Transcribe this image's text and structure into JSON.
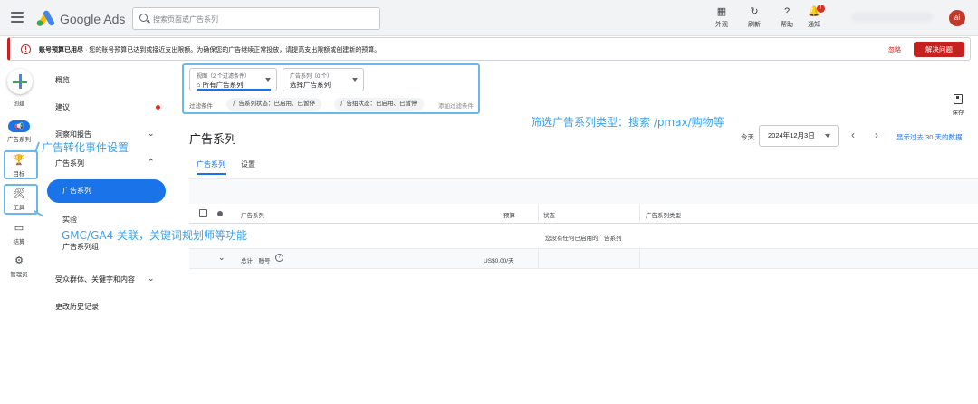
{
  "header": {
    "app_name": "Google Ads",
    "search_placeholder": "搜索页面或广告系列",
    "buttons": [
      {
        "label": "外观",
        "icon": "appearance-icon"
      },
      {
        "label": "刷新",
        "icon": "refresh-icon"
      },
      {
        "label": "帮助",
        "icon": "help-icon"
      },
      {
        "label": "通知",
        "icon": "bell-icon",
        "badge": "!"
      }
    ],
    "avatar_text": "ai"
  },
  "alert": {
    "title": "账号预算已用尽",
    "message": " · 您的账号预算已达到或接近支出限额。为确保您的广告继续正常投放，请提高支出限额或创建新的预算。",
    "ignore_label": "忽略",
    "resolve_label": "解决问题"
  },
  "rail": {
    "create": "创建",
    "campaigns": "广告系列",
    "goals": "目标",
    "tools": "工具",
    "billing": "结算",
    "admin": "管理员"
  },
  "nav": {
    "overview": "概览",
    "recommendations": "建议",
    "insights": "洞察和报告",
    "campaigns_group": "广告系列",
    "campaigns": "广告系列",
    "experiments": "实验",
    "campaign_groups": "广告系列组",
    "audiences": "受众群体、关键字和内容",
    "change_history": "更改历史记录"
  },
  "filters": {
    "view_caption": "视图（2 个过滤条件）",
    "view_value": "所有广告系列",
    "campaign_caption": "广告系列（0 个）",
    "campaign_value": "选择广告系列",
    "filter_label": "过滤条件",
    "chip1": "广告系列状态：已启用、已暂停",
    "chip2": "广告组状态：已启用、已暂停",
    "add_filter": "添加过滤条件"
  },
  "annotations": {
    "filter_note": "筛选广告系列类型：搜索 /pmax/购物等",
    "goals_note": "广告转化事件设置",
    "tools_note": "GMC/GA4 关联，关键词规划师等功能"
  },
  "page": {
    "title": "广告系列",
    "today": "今天",
    "date": "2024年12月3日",
    "date_range": "显示过去 30 天的数据",
    "save": "保存",
    "tabs": [
      "广告系列",
      "设置"
    ]
  },
  "table": {
    "columns": [
      "广告系列",
      "预算",
      "状态",
      "广告系列类型"
    ],
    "empty_message": "您没有任何已启用的广告系列",
    "total_label": "总计：账号",
    "total_budget": "US$0.00/天"
  },
  "colors": {
    "accent": "#1a73e8",
    "alert_red": "#c5221f",
    "annotation_blue": "#3aa0e8"
  }
}
